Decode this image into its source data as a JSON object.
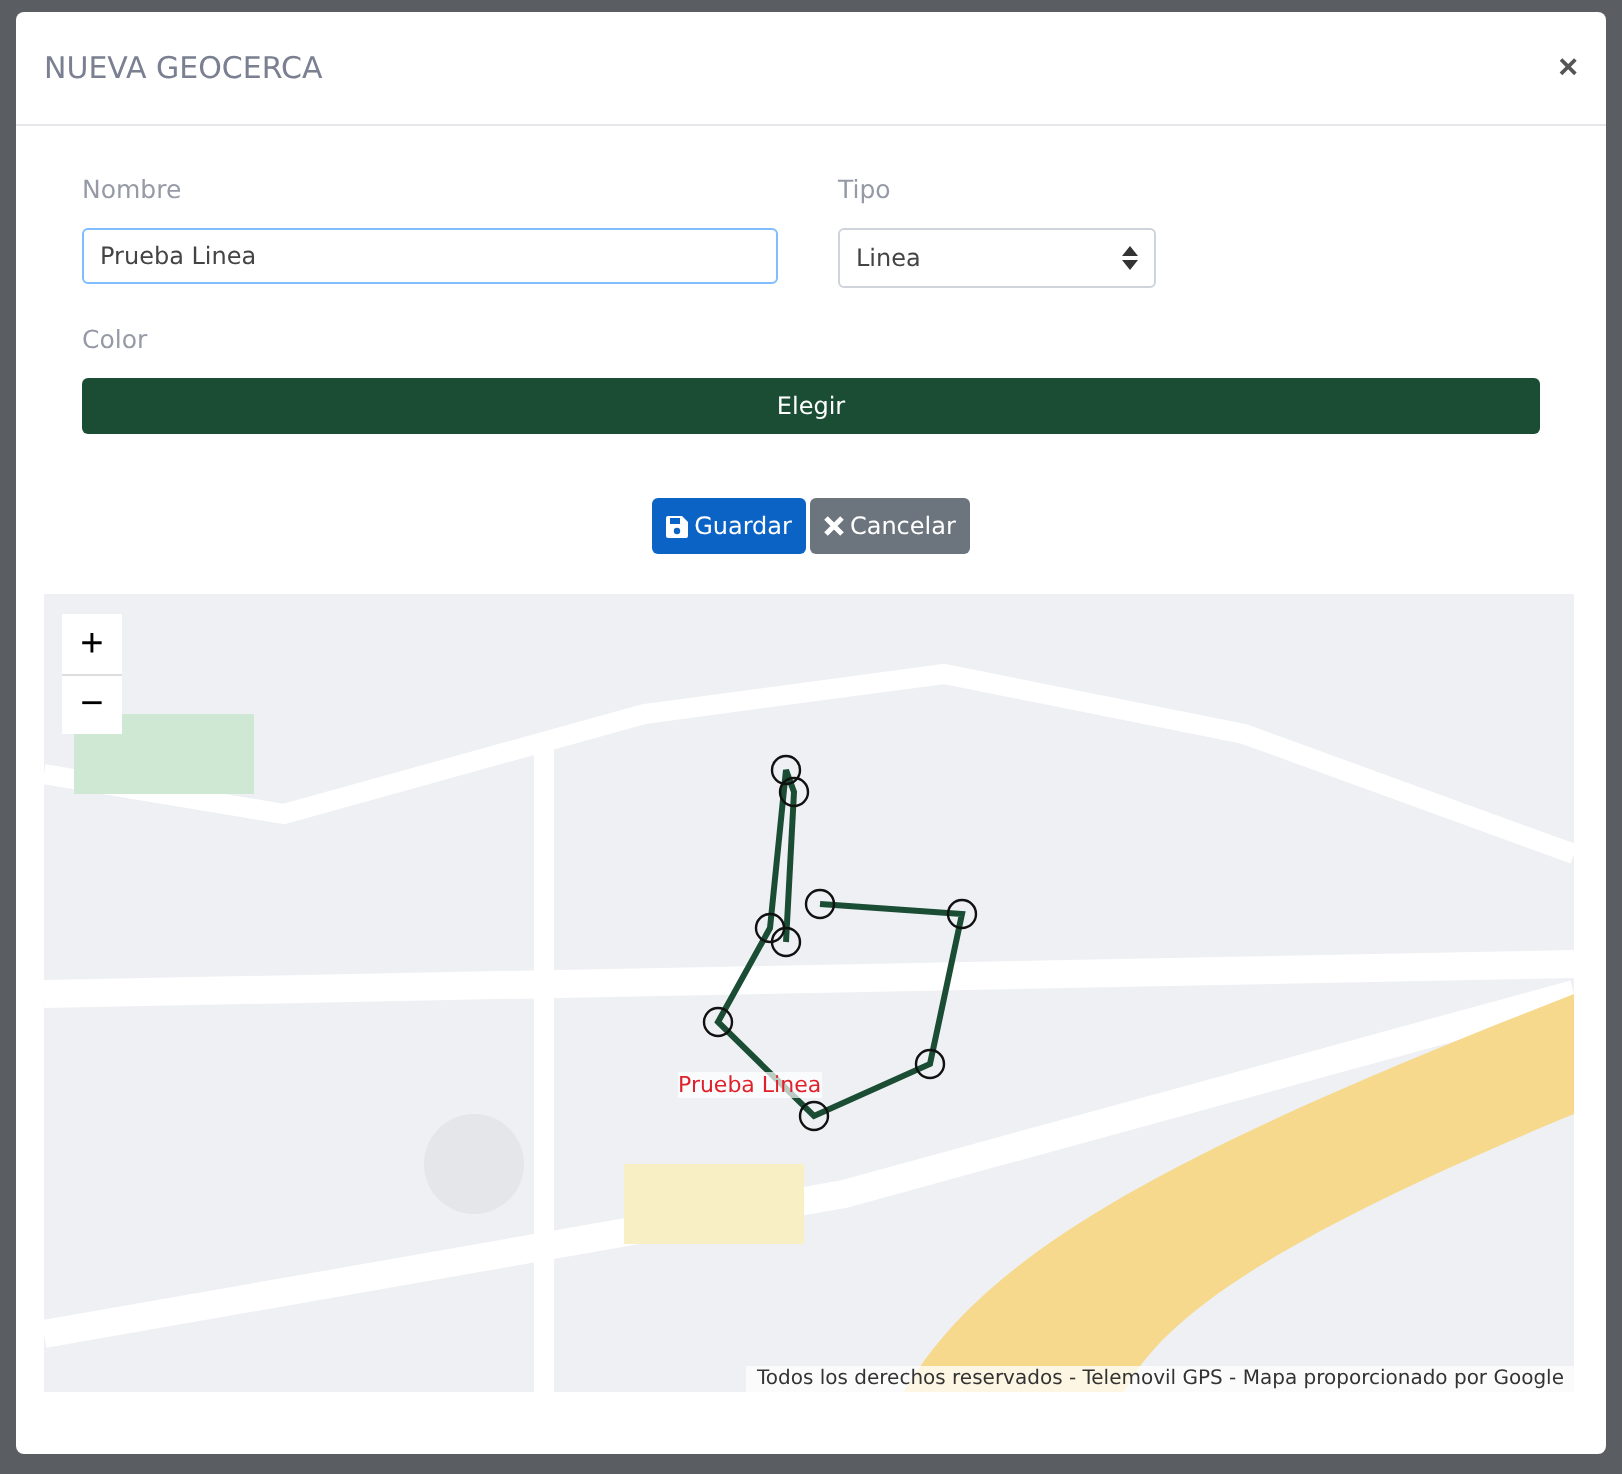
{
  "modal": {
    "title": "NUEVA GEOCERCA",
    "close": "×"
  },
  "form": {
    "name_label": "Nombre",
    "name_value": "Prueba Linea",
    "type_label": "Tipo",
    "type_value": "Linea",
    "color_label": "Color",
    "color_button": "Elegir",
    "color": "#1b4d35"
  },
  "buttons": [
    {
      "kind": "save",
      "label": "Guardar"
    },
    {
      "kind": "cancel",
      "label": "Cancelar"
    }
  ],
  "map": {
    "zoom_in": "+",
    "zoom_out": "−",
    "shape_label": "Prueba Linea",
    "attribution": "Todos los derechos reservados - Telemovil GPS - Mapa proporcionado por Google"
  }
}
